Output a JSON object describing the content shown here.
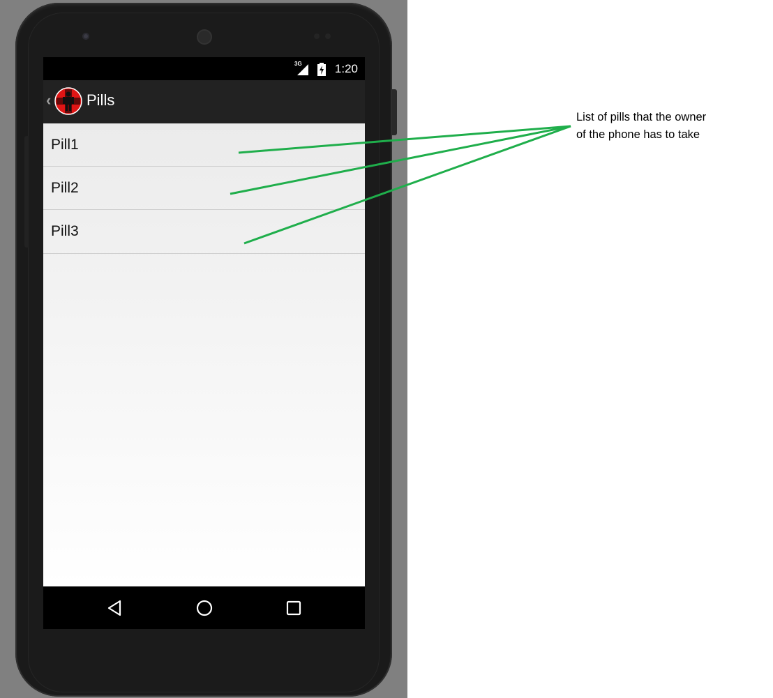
{
  "status_bar": {
    "network": "3G",
    "time": "1:20"
  },
  "action_bar": {
    "back_glyph": "‹",
    "title": "Pills",
    "logo_icon": "medical-cross-person-icon"
  },
  "pill_list": {
    "items": [
      {
        "label": "Pill1"
      },
      {
        "label": "Pill2"
      },
      {
        "label": "Pill3"
      }
    ]
  },
  "nav_bar": {
    "back_icon": "triangle-back-icon",
    "home_icon": "circle-home-icon",
    "recents_icon": "square-recents-icon"
  },
  "annotation": {
    "line1": "List of pills that the owner",
    "line2": "of the phone has to take",
    "arrow_color": "#1fae4b"
  },
  "colors": {
    "backdrop": "#808080",
    "action_bar": "#222222",
    "logo_red": "#e01515"
  }
}
